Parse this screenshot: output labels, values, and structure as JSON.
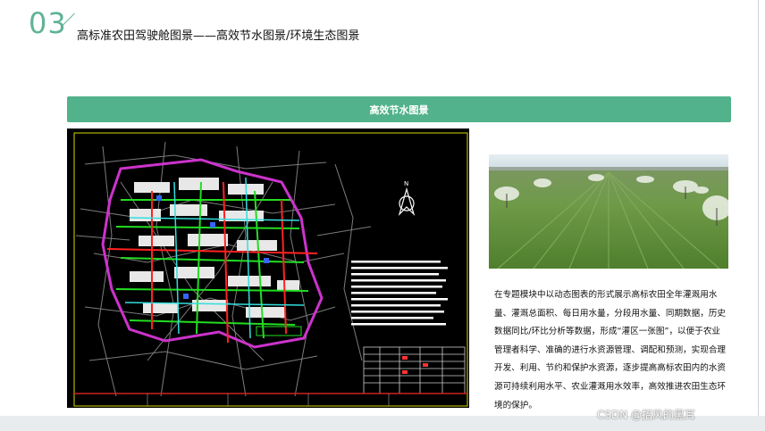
{
  "header": {
    "section_number": "03",
    "title": "高标准农田驾驶舱图景——高效节水图景/环境生态图景"
  },
  "section_bar": {
    "label": "高效节水图景"
  },
  "map": {
    "north_label": "N"
  },
  "photo": {
    "subject": "sprinkler-irrigated green farmland"
  },
  "description": "在专题模块中以动态图表的形式展示高标农田全年灌溉用水量、灌溉总面积、每日用水量，分段用水量、同期数据，历史数据同比/环比分析等数据，形成“灌区一张图”，以便于农业管理者科学、准确的进行水资源管理、调配和预测，实现合理开发、利用、节约和保护水资源，逐步提高高标农田内的水资源可持续利用水平、农业灌溉用水效率，高效推进农田生态环境的保护。",
  "watermark": "CSDN @招风的黑耳",
  "colors": {
    "accent": "#52b28b",
    "number": "#5fb394"
  }
}
